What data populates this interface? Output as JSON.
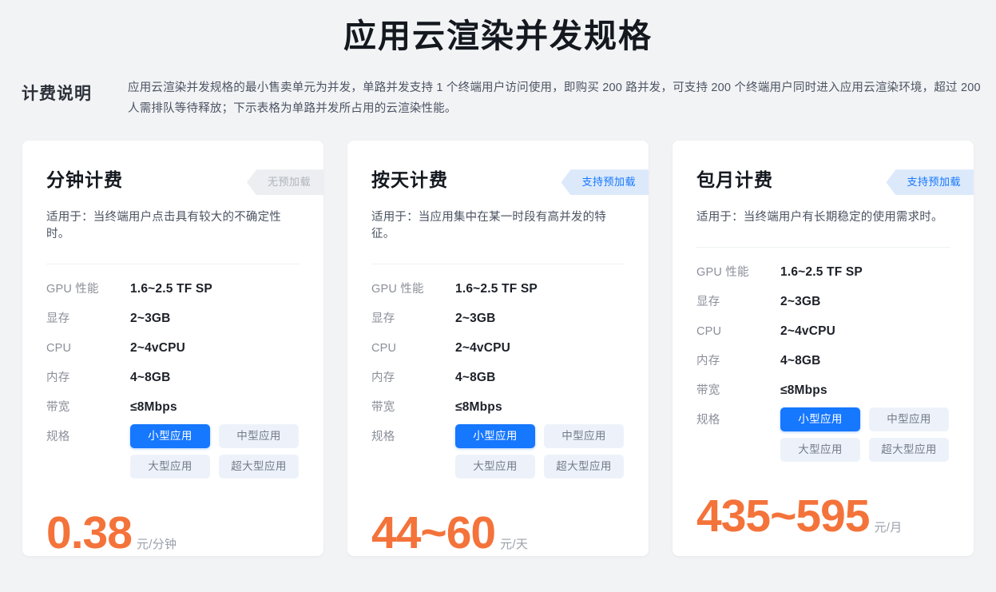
{
  "page": {
    "title": "应用云渲染并发规格",
    "background_color": "#f2f3f5"
  },
  "note": {
    "title": "计费说明",
    "body": "应用云渲染并发规格的最小售卖单元为并发，单路并发支持 1 个终端用户访问使用，即购买 200 路并发，可支持 200 个终端用户同时进入应用云渲染环境，超过 200 人需排队等待释放；下示表格为单路并发所占用的云渲染性能。"
  },
  "colors": {
    "accent_blue": "#1677ff",
    "badge_blue_bg": "#dbe9fb",
    "badge_grey_bg": "#eceef1",
    "price_orange": "#f4733a",
    "option_bg": "#edf2fa"
  },
  "spec_labels": {
    "gpu": "GPU 性能",
    "vram": "显存",
    "cpu": "CPU",
    "memory": "内存",
    "bandwidth": "带宽",
    "scale": "规格"
  },
  "cards": [
    {
      "title": "分钟计费",
      "badge": {
        "label": "无预加载",
        "style": "grey"
      },
      "subtitle": "适用于：当终端用户点击具有较大的不确定性时。",
      "specs": {
        "gpu": "1.6~2.5 TF SP",
        "vram": "2~3GB",
        "cpu": "2~4vCPU",
        "memory": "4~8GB",
        "bandwidth": "≤8Mbps"
      },
      "options": [
        {
          "label": "小型应用",
          "selected": true
        },
        {
          "label": "中型应用",
          "selected": false
        },
        {
          "label": "大型应用",
          "selected": false
        },
        {
          "label": "超大型应用",
          "selected": false
        }
      ],
      "price": {
        "amount": "0.38",
        "unit": "元/分钟"
      }
    },
    {
      "title": "按天计费",
      "badge": {
        "label": "支持预加载",
        "style": "blue"
      },
      "subtitle": "适用于：当应用集中在某一时段有高并发的特征。",
      "specs": {
        "gpu": "1.6~2.5 TF SP",
        "vram": "2~3GB",
        "cpu": "2~4vCPU",
        "memory": "4~8GB",
        "bandwidth": "≤8Mbps"
      },
      "options": [
        {
          "label": "小型应用",
          "selected": true
        },
        {
          "label": "中型应用",
          "selected": false
        },
        {
          "label": "大型应用",
          "selected": false
        },
        {
          "label": "超大型应用",
          "selected": false
        }
      ],
      "price": {
        "amount": "44~60",
        "unit": "元/天"
      }
    },
    {
      "title": "包月计费",
      "badge": {
        "label": "支持预加载",
        "style": "blue"
      },
      "subtitle": "适用于：当终端用户有长期稳定的使用需求时。",
      "specs": {
        "gpu": "1.6~2.5 TF SP",
        "vram": "2~3GB",
        "cpu": "2~4vCPU",
        "memory": "4~8GB",
        "bandwidth": "≤8Mbps"
      },
      "options": [
        {
          "label": "小型应用",
          "selected": true
        },
        {
          "label": "中型应用",
          "selected": false
        },
        {
          "label": "大型应用",
          "selected": false
        },
        {
          "label": "超大型应用",
          "selected": false
        }
      ],
      "price": {
        "amount": "435~595",
        "unit": "元/月"
      }
    }
  ]
}
